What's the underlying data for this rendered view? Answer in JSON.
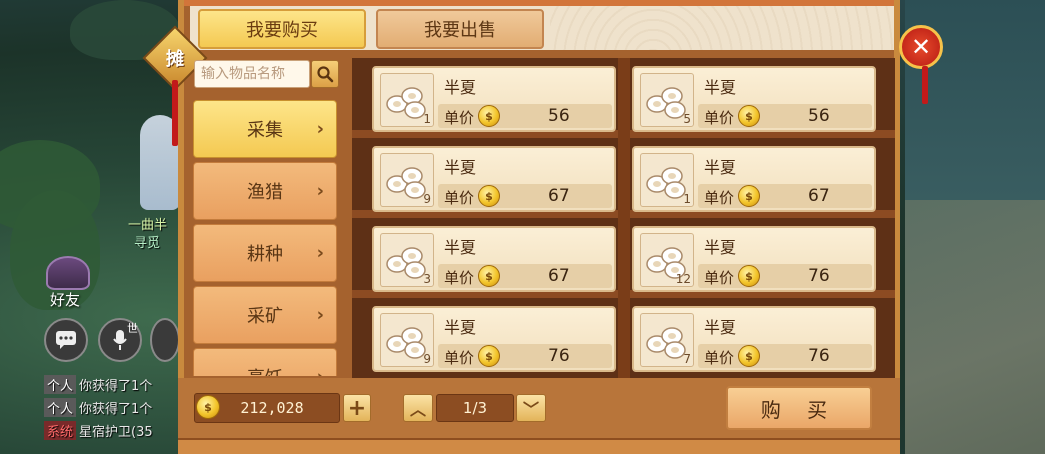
{
  "tabs": {
    "buy_label": "我要购买",
    "sell_label": "我要出售"
  },
  "stall_badge": "摊",
  "search": {
    "placeholder": "输入物品名称"
  },
  "categories": [
    {
      "label": "采集",
      "active": true
    },
    {
      "label": "渔猎",
      "active": false
    },
    {
      "label": "耕种",
      "active": false
    },
    {
      "label": "采矿",
      "active": false
    },
    {
      "label": "烹饪",
      "active": false
    }
  ],
  "price_label": "单价",
  "items": [
    {
      "name": "半夏",
      "qty": "1",
      "price": "56"
    },
    {
      "name": "半夏",
      "qty": "5",
      "price": "56"
    },
    {
      "name": "半夏",
      "qty": "9",
      "price": "67"
    },
    {
      "name": "半夏",
      "qty": "1",
      "price": "67"
    },
    {
      "name": "半夏",
      "qty": "3",
      "price": "67"
    },
    {
      "name": "半夏",
      "qty": "12",
      "price": "76"
    },
    {
      "name": "半夏",
      "qty": "9",
      "price": "76"
    },
    {
      "name": "半夏",
      "qty": "7",
      "price": "76"
    }
  ],
  "footer": {
    "money": "212,028",
    "add_symbol": "+",
    "page": "1/3",
    "buy_label": "购 买"
  },
  "world": {
    "npc_name": "一曲半",
    "npc_sub": "寻觅",
    "friend_label": "好友",
    "voice_channel": "世",
    "chat": [
      {
        "tag": "个人",
        "text": "你获得了1个",
        "sys": false
      },
      {
        "tag": "个人",
        "text": "你获得了1个",
        "sys": false
      },
      {
        "tag": "系统",
        "text": "星宿护卫(35",
        "sys": true
      }
    ]
  },
  "close_symbol": "✕",
  "icons": {
    "search": "search-icon",
    "close": "close-icon",
    "coin": "coin-icon",
    "chevron": "chevron-right-icon",
    "page_prev": "chevron-up-icon",
    "page_next": "chevron-down-icon"
  },
  "colors": {
    "accent_gold": "#f4c952",
    "panel_brown": "#a5622e",
    "close_red": "#c5281a"
  }
}
